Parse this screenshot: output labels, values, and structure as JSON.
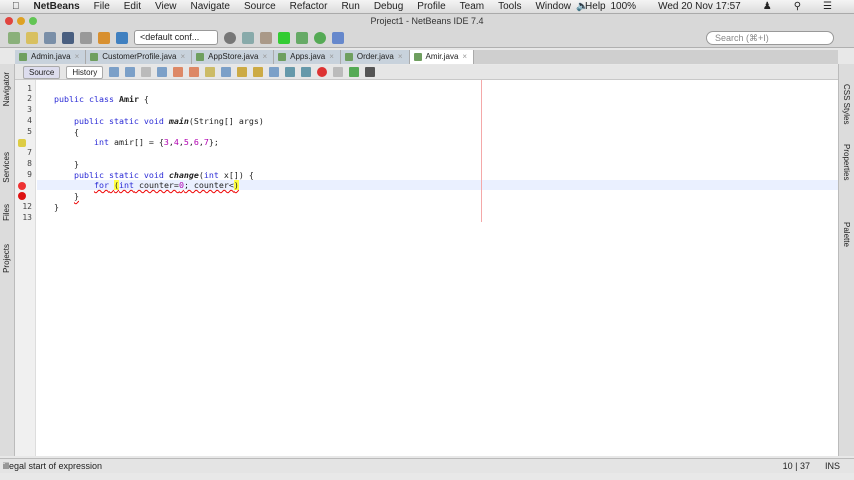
{
  "menubar": {
    "app": "NetBeans",
    "items": [
      "File",
      "Edit",
      "View",
      "Navigate",
      "Source",
      "Refactor",
      "Run",
      "Debug",
      "Profile",
      "Team",
      "Tools",
      "Window",
      "Help"
    ],
    "battery": "100%",
    "clock": "Wed 20 Nov  17:57"
  },
  "window": {
    "title": "Project1 - NetBeans IDE 7.4"
  },
  "toolbar": {
    "config": "<default conf...",
    "search_placeholder": "Search (⌘+I)"
  },
  "tabs": [
    {
      "label": "Admin.java"
    },
    {
      "label": "CustomerProfile.java"
    },
    {
      "label": "AppStore.java"
    },
    {
      "label": "Apps.java"
    },
    {
      "label": "Order.java"
    },
    {
      "label": "Amir.java"
    }
  ],
  "editor_toolbar": {
    "source": "Source",
    "history": "History"
  },
  "side_panels": {
    "left": [
      "Navigator",
      "Services",
      "Files",
      "Projects"
    ],
    "right": [
      "CSS Styles",
      "Properties",
      "Palette"
    ]
  },
  "code": {
    "line_numbers": [
      "1",
      "2",
      "3",
      "4",
      "5",
      "",
      "7",
      "8",
      "9",
      "",
      "",
      "12",
      "13"
    ]
  },
  "status": {
    "message": "illegal start of expression",
    "position": "10 | 37",
    "mode": "INS"
  }
}
